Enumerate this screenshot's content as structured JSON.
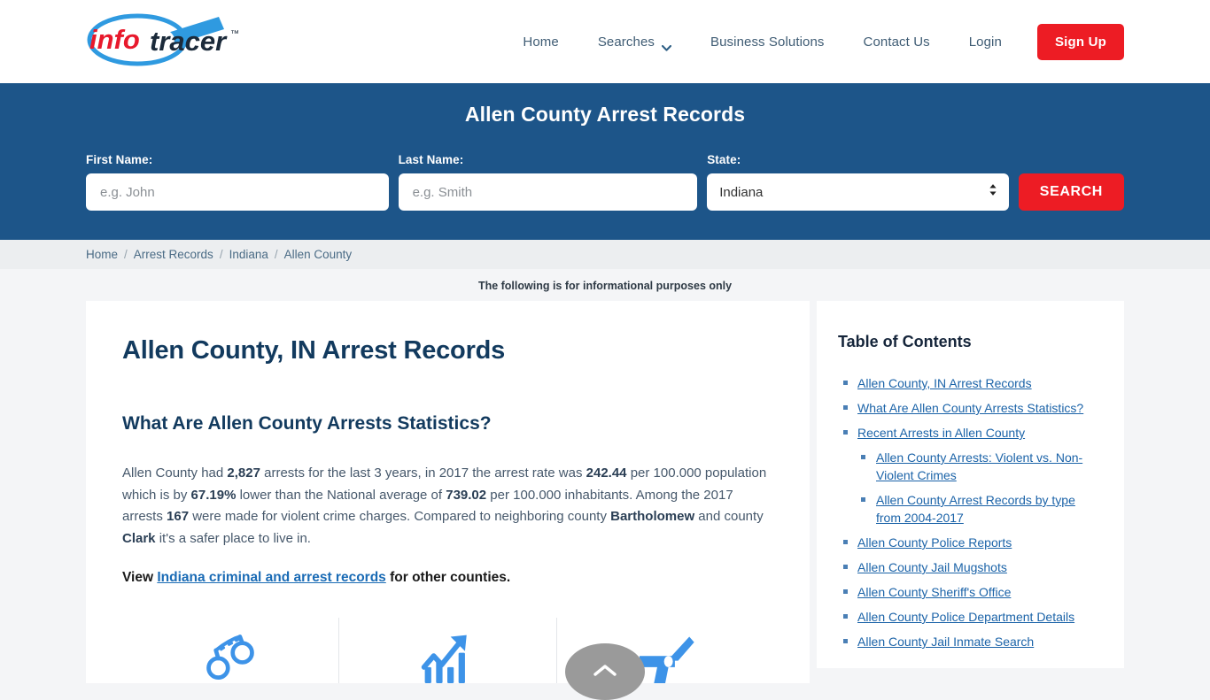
{
  "header": {
    "logo": {
      "part1": "info",
      "part2": "tracer",
      "trademark": "™",
      "part1_color": "#e8192c",
      "part2_color": "#1b2a3a",
      "glass_color": "#2f9ae0"
    },
    "nav": [
      {
        "label": "Home",
        "icon": null
      },
      {
        "label": "Searches",
        "icon": "chevron-down-icon"
      },
      {
        "label": "Business Solutions",
        "icon": null
      },
      {
        "label": "Contact Us",
        "icon": null
      },
      {
        "label": "Login",
        "icon": null
      }
    ],
    "signup_label": "Sign Up",
    "signup_color": "#ed1c24"
  },
  "banner": {
    "title": "Allen County Arrest Records",
    "background_color": "#1d5589",
    "fields": {
      "first_name": {
        "label": "First Name:",
        "placeholder": "e.g. John",
        "value": ""
      },
      "last_name": {
        "label": "Last Name:",
        "placeholder": "e.g. Smith",
        "value": ""
      },
      "state": {
        "label": "State:",
        "selected": "Indiana"
      }
    },
    "search_label": "SEARCH"
  },
  "breadcrumb": {
    "separator": "/",
    "items": [
      "Home",
      "Arrest Records",
      "Indiana",
      "Allen County"
    ]
  },
  "notice": "The following is for informational purposes only",
  "main": {
    "page_title": "Allen County, IN Arrest Records",
    "section_title": "What Are Allen County Arrests Statistics?",
    "stats_paragraph": {
      "s1": "Allen County had ",
      "v1": "2,827",
      "s2": " arrests for the last 3 years, in 2017 the arrest rate was ",
      "v2": "242.44",
      "s3": " per 100.000 population which is by ",
      "v3": "67.19%",
      "s4": " lower than the National average of ",
      "v4": "739.02",
      "s5": " per 100.000 inhabitants. Among the 2017 arrests ",
      "v5": "167",
      "s6": " were made for violent crime charges. Compared to neighboring county ",
      "v6": "Bartholomew",
      "s7": " and county ",
      "v7": "Clark",
      "s8": " it's a safer place to live in."
    },
    "view_line": {
      "prefix": "View ",
      "link": "Indiana criminal and arrest records",
      "suffix": " for other counties."
    },
    "icons": [
      {
        "name": "handcuffs-icon",
        "color": "#3d93e8"
      },
      {
        "name": "trending-up-chart-icon",
        "color": "#3d93e8"
      },
      {
        "name": "gun-icon",
        "color": "#3d93e8"
      }
    ]
  },
  "sidebar": {
    "title": "Table of Contents",
    "items": [
      {
        "label": "Allen County, IN Arrest Records",
        "children": []
      },
      {
        "label": "What Are Allen County Arrests Statistics?",
        "children": []
      },
      {
        "label": "Recent Arrests in Allen County",
        "children": [
          {
            "label": "Allen County Arrests: Violent vs. Non-Violent Crimes"
          },
          {
            "label": "Allen County Arrest Records by type from 2004-2017"
          }
        ]
      },
      {
        "label": "Allen County Police Reports",
        "children": []
      },
      {
        "label": "Allen County Jail Mugshots",
        "children": []
      },
      {
        "label": "Allen County Sheriff's Office",
        "children": []
      },
      {
        "label": "Allen County Police Department Details",
        "children": []
      },
      {
        "label": "Allen County Jail Inmate Search",
        "children": []
      }
    ]
  },
  "scroll_top": {
    "name": "scroll-to-top-button",
    "icon": "chevron-up-icon"
  }
}
